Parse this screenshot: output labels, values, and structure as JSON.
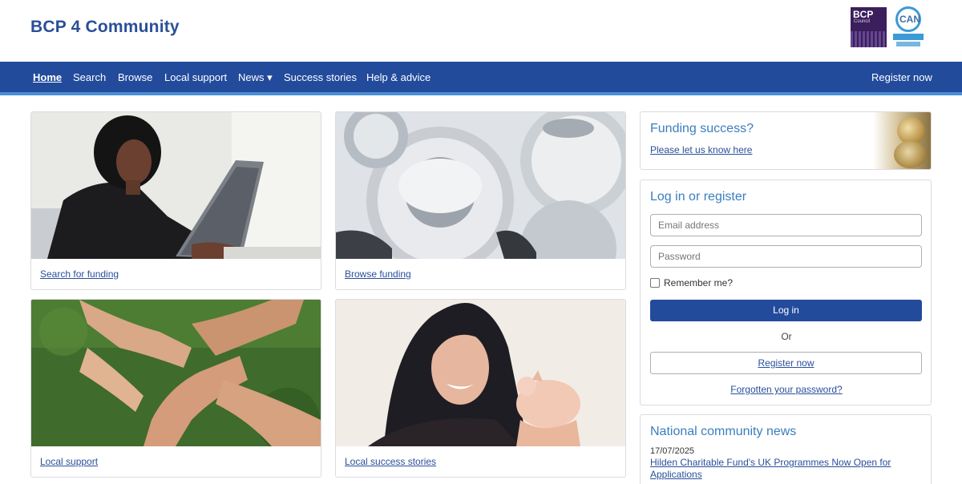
{
  "header": {
    "site_title": "BCP 4 Community",
    "logo_bcp_text": "BCP",
    "logo_bcp_sub": "Council",
    "logo_can_text": "CAN"
  },
  "nav": {
    "items": [
      {
        "label": "Home",
        "active": true
      },
      {
        "label": "Search"
      },
      {
        "label": "Browse"
      },
      {
        "label": "Local support"
      },
      {
        "label": "News ▾"
      },
      {
        "label": "Success stories"
      },
      {
        "label": "Help & advice"
      }
    ],
    "register_label": "Register now"
  },
  "cards": [
    {
      "link": "Search for funding",
      "image": "woman-at-laptop"
    },
    {
      "link": "Browse funding",
      "image": "gears"
    },
    {
      "link": "Local support",
      "image": "linked-hands"
    },
    {
      "link": "Local success stories",
      "image": "woman-with-piggy-bank"
    }
  ],
  "funding": {
    "title": "Funding success?",
    "link": "Please let us know here"
  },
  "login": {
    "title": "Log in or register",
    "email_placeholder": "Email address",
    "password_placeholder": "Password",
    "remember_label": "Remember me?",
    "login_button": "Log in",
    "or_text": "Or",
    "register_button": "Register now",
    "forgot_link": "Forgotten your password?"
  },
  "news": {
    "title": "National community news",
    "items": [
      {
        "date": "17/07/2025",
        "headline": "Hilden Charitable Fund's UK Programmes Now Open for Applications"
      }
    ]
  },
  "colors": {
    "brand_blue": "#234b9c",
    "accent_blue": "#3a7ebf",
    "nav_underline": "#4a8fd6"
  }
}
